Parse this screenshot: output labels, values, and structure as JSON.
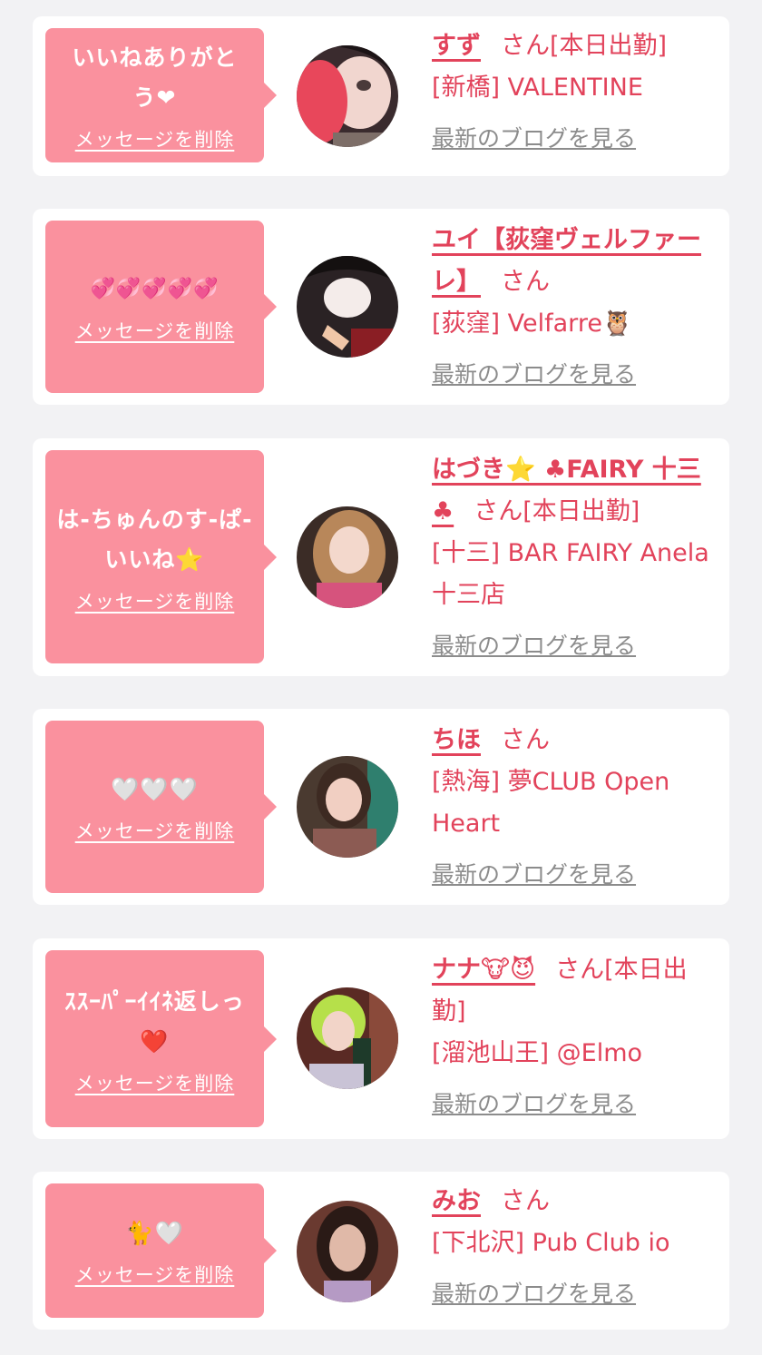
{
  "colors": {
    "background": "#f2f2f4",
    "card": "#ffffff",
    "bubble": "#fa919e",
    "accent": "#e2435b",
    "link_gray": "#8c8c8c"
  },
  "delete_label": "メッセージを削除",
  "blog_label": "最新のブログを見る",
  "honorific": "さん",
  "cards": [
    {
      "message": "いいねありがとう❤",
      "name": "すず",
      "status": "[本日出勤]",
      "venue": "[新橋] VALENTINE"
    },
    {
      "message": "💞💞💞💞💞",
      "name": "ユイ【荻窪ヴェルファーレ】",
      "status": "",
      "venue": "[荻窪] Velfarre🦉"
    },
    {
      "message": "は-ちゅんのす-ぱ-いいね⭐️",
      "name": "はづき⭐️ ♣FAIRY 十三♣",
      "status": "[本日出勤]",
      "venue": "[十三] BAR FAIRY Anela 十三店"
    },
    {
      "message": "🤍🤍🤍",
      "name": "ちほ",
      "status": "",
      "venue": "[熱海] 夢CLUB Open Heart"
    },
    {
      "message": "ｽｽｰﾊﾟｰｲｲﾈ返しっ❤️",
      "name": "ナナ🐮😈",
      "status": "[本日出勤]",
      "venue": "[溜池山王] @Elmo"
    },
    {
      "message": "🐈🤍",
      "name": "みお",
      "status": "",
      "venue": "[下北沢] Pub Club io"
    }
  ]
}
